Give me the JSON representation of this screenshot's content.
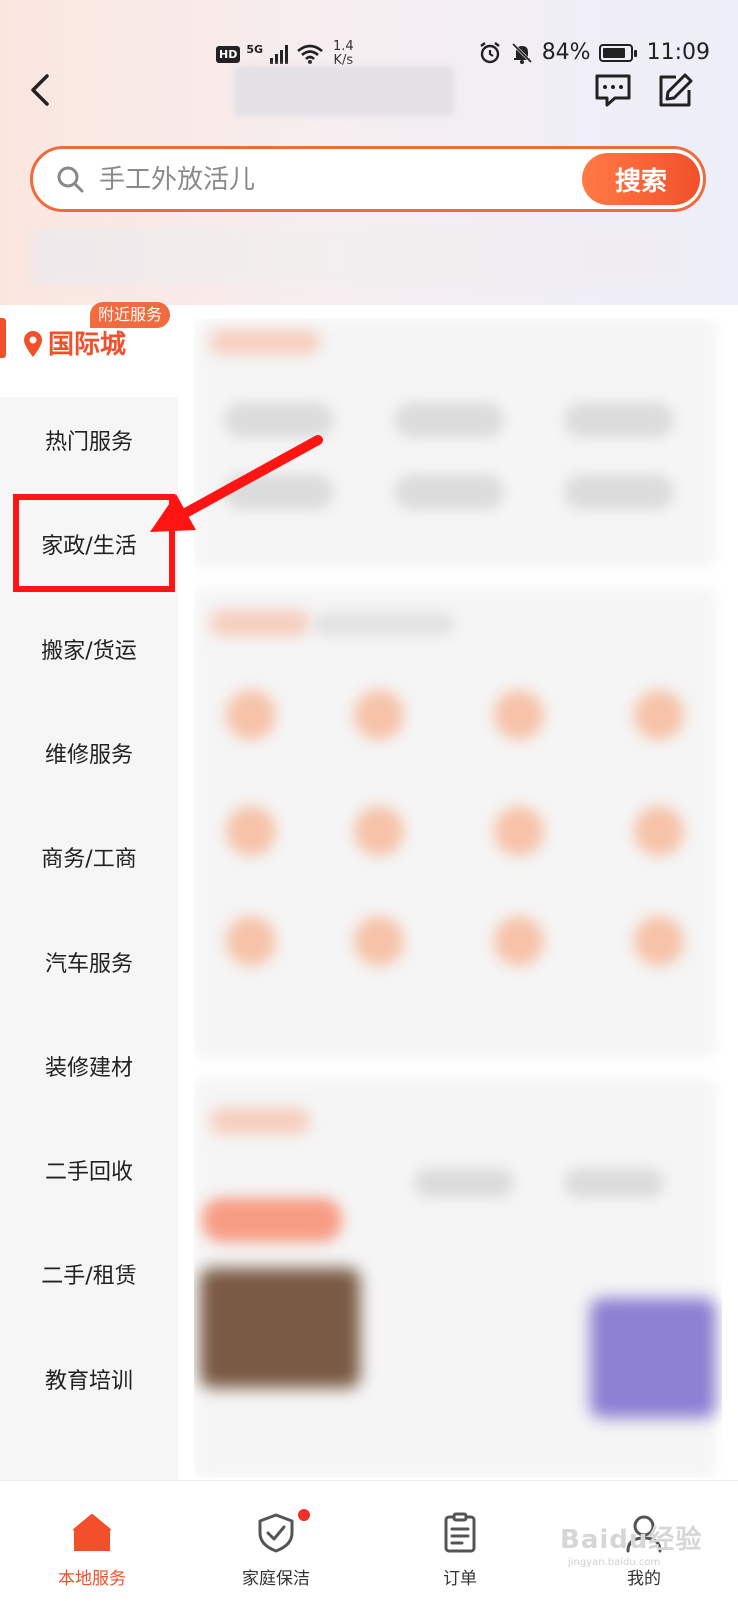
{
  "status_bar": {
    "hd": "HD",
    "network": "5G",
    "speed_value": "1.4",
    "speed_unit": "K/s",
    "battery": "84%",
    "battery_level": 0.84,
    "time": "11:09"
  },
  "search": {
    "placeholder": "手工外放活儿",
    "button_label": "搜索"
  },
  "sidebar": {
    "location_badge": "附近服务",
    "location_name": "国际城",
    "categories": [
      {
        "label": "热门服务"
      },
      {
        "label": "家政/生活"
      },
      {
        "label": "搬家/货运"
      },
      {
        "label": "维修服务"
      },
      {
        "label": "商务/工商"
      },
      {
        "label": "汽车服务"
      },
      {
        "label": "装修建材"
      },
      {
        "label": "二手回收"
      },
      {
        "label": "二手/租赁"
      },
      {
        "label": "教育培训"
      }
    ]
  },
  "bottom_nav": {
    "items": [
      {
        "label": "本地服务",
        "icon": "home-icon",
        "active": true
      },
      {
        "label": "家庭保洁",
        "icon": "shield-check-icon",
        "badge": true
      },
      {
        "label": "订单",
        "icon": "clipboard-icon"
      },
      {
        "label": "我的",
        "icon": "user-icon"
      }
    ]
  },
  "watermark": {
    "text": "Baidu经验",
    "sub": "jingyan.baidu.com"
  },
  "colors": {
    "accent": "#f2502a",
    "highlight": "#ff1414"
  }
}
